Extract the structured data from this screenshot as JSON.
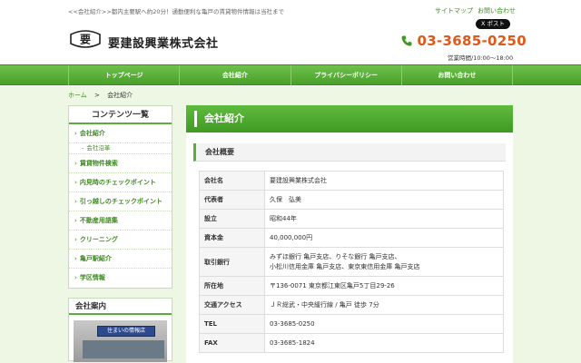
{
  "header": {
    "tagline": "<<会社紹介>>都内主要駅へ約20分！通勤便利な亀戸の賃貸物件情報は当社まで",
    "sitemap_link": "サイトマップ",
    "contact_link": "お問い合わせ",
    "x_post_button": "X ポスト",
    "logo_glyph": "要",
    "company_name": "要建設興業株式会社",
    "phone": "03-3685-0250",
    "hours": "営業時間/10:00～18:00",
    "phone_color": "#e0581a"
  },
  "nav": {
    "items": [
      {
        "label": "トップページ"
      },
      {
        "label": "会社紹介"
      },
      {
        "label": "プライバシーポリシー"
      },
      {
        "label": "お問い合わせ"
      }
    ]
  },
  "breadcrumb": {
    "home": "ホーム",
    "sep": ">",
    "current": "会社紹介"
  },
  "sidebar": {
    "title": "コンテンツ一覧",
    "items": [
      {
        "label": "会社紹介"
      },
      {
        "label": "賃貸物件検索"
      },
      {
        "label": "内見時のチェックポイント"
      },
      {
        "label": "引っ越しのチェックポイント"
      },
      {
        "label": "不動産用語集"
      },
      {
        "label": "クリーニング"
      },
      {
        "label": "亀戸駅紹介"
      },
      {
        "label": "学区情報"
      }
    ],
    "sub_item": "会社沿革",
    "info_title": "会社案内",
    "photo_sign": "住まいの情報店"
  },
  "main": {
    "title": "会社紹介",
    "section_title": "会社概要",
    "rows": [
      {
        "label": "会社名",
        "value": "要建設興業株式会社"
      },
      {
        "label": "代表者",
        "value": "久保　弘美"
      },
      {
        "label": "設立",
        "value": "昭和44年"
      },
      {
        "label": "資本金",
        "value": "40,000,000円"
      },
      {
        "label": "取引銀行",
        "value": "みずほ銀行 亀戸支店、りそな銀行 亀戸支店、",
        "value2": "小松川信用金庫 亀戸支店、東京東信用金庫 亀戸支店"
      },
      {
        "label": "所在地",
        "value": "〒136-0071 東京都江東区亀戸5丁目29-26"
      },
      {
        "label": "交通アクセス",
        "value": "ＪＲ総武・中央緩行線 / 亀戸 徒歩 7分"
      },
      {
        "label": "TEL",
        "value": "03-3685-0250"
      },
      {
        "label": "FAX",
        "value": "03-3685-1824"
      }
    ]
  },
  "colors": {
    "brand_green": "#4a9f2b",
    "accent_orange": "#e0581a"
  }
}
